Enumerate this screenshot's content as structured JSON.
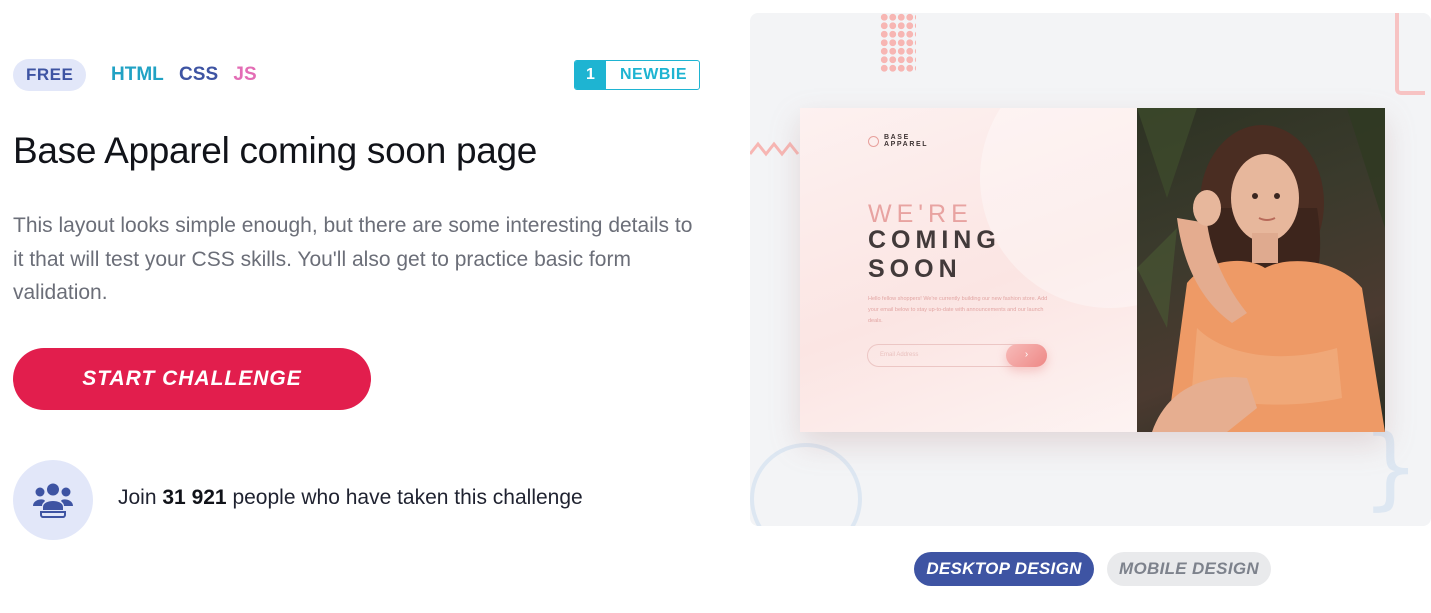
{
  "challenge": {
    "price_badge": "FREE",
    "languages": [
      "HTML",
      "CSS",
      "JS"
    ],
    "level_number": "1",
    "level_name": "NEWBIE",
    "title": "Base Apparel coming soon page",
    "description": "This layout looks simple enough, but there are some interesting details to it that will test your CSS skills. You'll also get to practice basic form validation.",
    "start_button": "START CHALLENGE",
    "join_prefix": "Join",
    "join_count": "31 921",
    "join_suffix": "people who have taken this challenge"
  },
  "preview": {
    "mock": {
      "logo": "BASE APPAREL",
      "heading_light": "WE'RE",
      "heading_bold_1": "COMING",
      "heading_bold_2": "SOON",
      "body": "Hello fellow shoppers! We're currently building our new fashion store. Add your email below to stay up-to-date with announcements and our launch deals.",
      "email_placeholder": "Email Address",
      "submit_icon": "chevron-right-icon"
    },
    "buttons": {
      "desktop": "DESKTOP DESIGN",
      "mobile": "MOBILE DESIGN",
      "active": "desktop"
    }
  },
  "colors": {
    "accent_red": "#e21e4d",
    "primary_blue": "#3e54a3",
    "level_cyan": "#1eb4d2",
    "html_color": "#21a2c4",
    "js_color": "#e36db5"
  },
  "icons": [
    "users-icon",
    "chevron-right-icon"
  ]
}
